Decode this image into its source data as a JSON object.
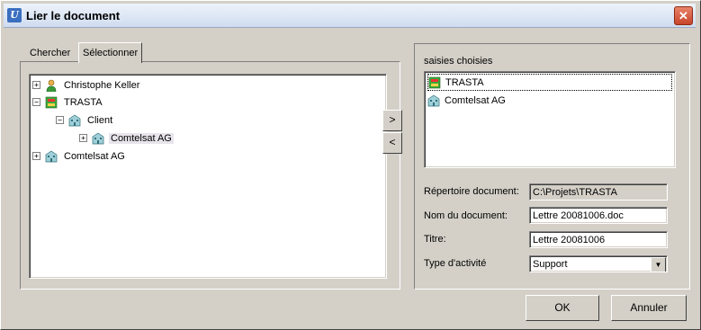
{
  "window": {
    "title": "Lier le document",
    "app_icon_letter": "U"
  },
  "tabs": [
    {
      "label": "Chercher",
      "active": false
    },
    {
      "label": "Sélectionner",
      "active": true
    }
  ],
  "tree": [
    {
      "label": "Christophe Keller",
      "icon": "person-icon",
      "expander": "+",
      "selected": false
    },
    {
      "label": "TRASTA",
      "icon": "project-icon",
      "expander": "−",
      "selected": false
    },
    {
      "label": "Client",
      "icon": "building-icon",
      "expander": "−",
      "selected": false
    },
    {
      "label": "Comtelsat AG",
      "icon": "building-icon",
      "expander": "+",
      "selected": true
    },
    {
      "label": "Comtelsat AG",
      "icon": "building-icon",
      "expander": "+",
      "selected": false
    }
  ],
  "move_buttons": {
    "add": ">",
    "remove": "<"
  },
  "chosen": {
    "heading": "saisies choisies",
    "items": [
      {
        "label": "TRASTA",
        "icon": "project-icon",
        "focused": true
      },
      {
        "label": "Comtelsat AG",
        "icon": "building-icon",
        "focused": false
      }
    ]
  },
  "form": {
    "directory_label": "Répertoire document:",
    "directory_value": "C:\\Projets\\TRASTA",
    "docname_label": "Nom du document:",
    "docname_value": "Lettre 20081006.doc",
    "title_label": "Titre:",
    "title_value": "Lettre 20081006",
    "activity_label": "Type d'activité",
    "activity_value": "Support"
  },
  "buttons": {
    "ok": "OK",
    "cancel": "Annuler"
  },
  "colors": {
    "close_button": "#d05a3c",
    "selection_bg": "#e8e4ec"
  }
}
